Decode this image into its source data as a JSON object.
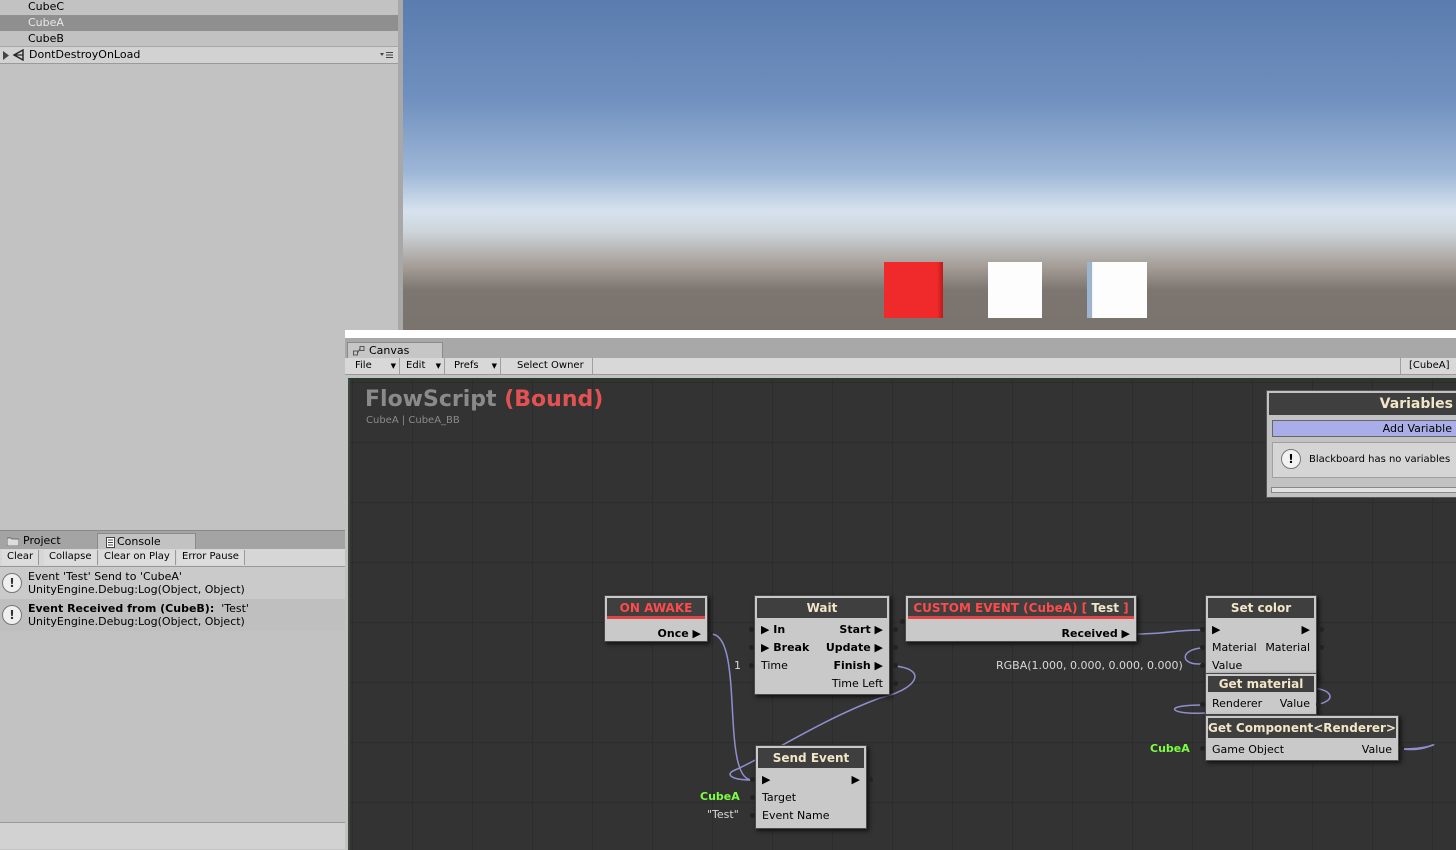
{
  "hierarchy": {
    "items": [
      {
        "label": "CubeC"
      },
      {
        "label": "CubeA"
      },
      {
        "label": "CubeB"
      }
    ],
    "scene_label": "DontDestroyOnLoad"
  },
  "console": {
    "tabs": {
      "project": "Project",
      "console": "Console"
    },
    "toolbar": {
      "clear": "Clear",
      "collapse": "Collapse",
      "clear_on_play": "Clear on Play",
      "error_pause": "Error Pause"
    },
    "logs": [
      {
        "line1": "Event 'Test' Send to 'CubeA'",
        "line2": "UnityEngine.Debug:Log(Object, Object)"
      },
      {
        "line1_bold": "Event Received from (CubeB):",
        "line1_rest": "'Test'",
        "line2": "UnityEngine.Debug:Log(Object, Object)"
      }
    ]
  },
  "canvas": {
    "tab_label": "Canvas",
    "menu": {
      "file": "File",
      "edit": "Edit",
      "prefs": "Prefs",
      "select_owner": "Select Owner"
    },
    "owner_badge": "[CubeA]",
    "title": "FlowScript",
    "title_bound": "(Bound)",
    "subtitle": "CubeA | CubeA_BB"
  },
  "blackboard": {
    "header": "Variables",
    "add_button": "Add Variable",
    "empty_message": "Blackboard has no variables"
  },
  "nodes": {
    "on_awake": {
      "title": "ON AWAKE",
      "once": "Once ▶"
    },
    "wait": {
      "title": "Wait",
      "in": "▶ In",
      "brk": "▶ Break",
      "time": "Time",
      "start": "Start ▶",
      "update": "Update ▶",
      "finish": "Finish ▶",
      "time_left": "Time Left",
      "time_value": "1"
    },
    "custom_event": {
      "title_a": "CUSTOM EVENT (CubeA) [",
      "title_b": "Test",
      "title_c": "]",
      "received": "Received ▶"
    },
    "set_color": {
      "title": "Set color",
      "flow_in": "▶",
      "flow_out": "▶",
      "material_l": "Material",
      "material_r": "Material",
      "value": "Value",
      "rgba": "RGBA(1.000, 0.000, 0.000, 0.000)"
    },
    "get_material": {
      "title": "Get material",
      "renderer": "Renderer",
      "value": "Value"
    },
    "get_component": {
      "title": "Get Component<Renderer>",
      "game_object": "Game Object",
      "value": "Value",
      "input_label": "CubeA"
    },
    "send_event": {
      "title": "Send Event",
      "flow_in": "▶",
      "flow_out": "▶",
      "target": "Target",
      "event_name": "Event Name",
      "target_value": "CubeA",
      "event_value": "\"Test\""
    }
  },
  "colors": {
    "accent_red": "#e04545",
    "graph_bg": "#333333",
    "cube_red": "#f02a2a",
    "node_body": "#c9c9c9",
    "link": "#8f8fd0",
    "green_value": "#7dff3f"
  }
}
